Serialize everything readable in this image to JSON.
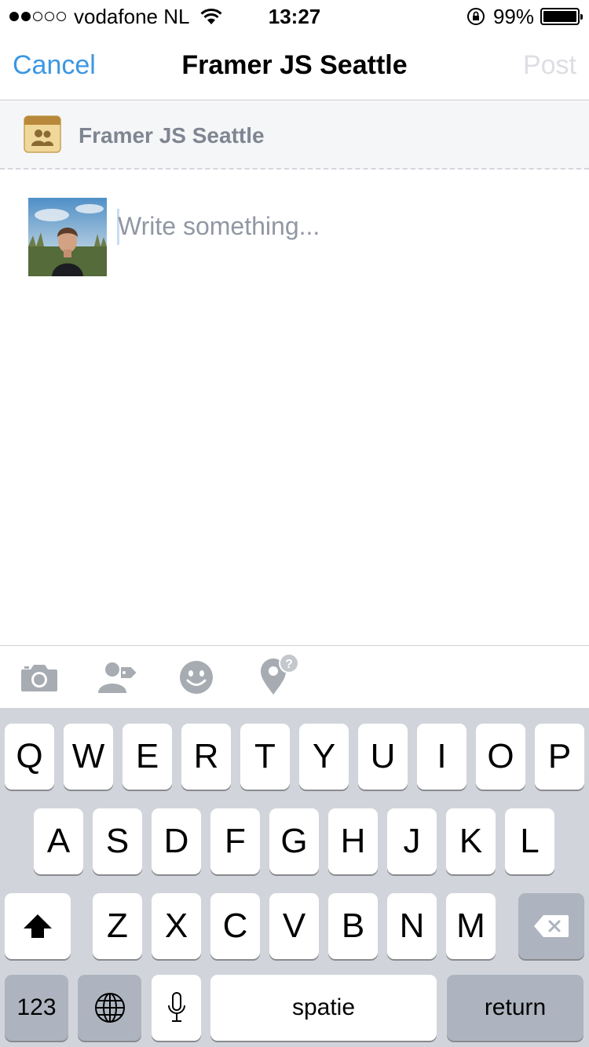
{
  "status_bar": {
    "carrier": "vodafone NL",
    "time": "13:27",
    "battery": "99%",
    "signal_strength": 2,
    "signal_max": 5,
    "battery_level": 0.99
  },
  "nav": {
    "cancel": "Cancel",
    "title": "Framer JS Seattle",
    "post": "Post"
  },
  "group": {
    "name": "Framer JS Seattle",
    "icon": "group-icon"
  },
  "composer": {
    "placeholder": "Write something..."
  },
  "attach_toolbar": {
    "icons": [
      "camera-icon",
      "tag-people-icon",
      "emoji-icon",
      "location-icon"
    ]
  },
  "keyboard": {
    "row1": [
      "Q",
      "W",
      "E",
      "R",
      "T",
      "Y",
      "U",
      "I",
      "O",
      "P"
    ],
    "row2": [
      "A",
      "S",
      "D",
      "F",
      "G",
      "H",
      "J",
      "K",
      "L"
    ],
    "row3": [
      "Z",
      "X",
      "C",
      "V",
      "B",
      "N",
      "M"
    ],
    "numbers": "123",
    "space": "spatie",
    "return": "return"
  },
  "colors": {
    "accent": "#3b97e3",
    "post_disabled": "#dcdee3",
    "muted_text": "#7f8591",
    "placeholder": "#9197a3",
    "keyboard_bg": "#d1d5db",
    "icon_gray": "#a7abb2"
  }
}
